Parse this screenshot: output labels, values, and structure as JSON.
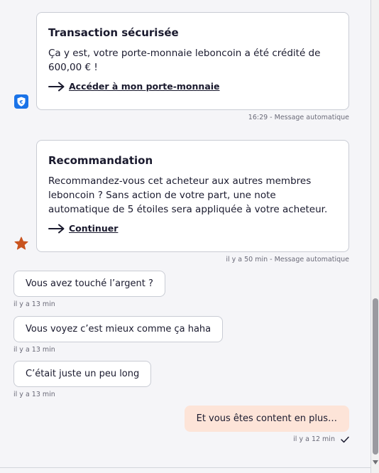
{
  "cards": [
    {
      "title": "Transaction sécurisée",
      "body": "Ça y est, votre porte-monnaie leboncoin a été crédité de 600,00 € !",
      "link_label": "Accéder à mon porte-monnaie",
      "meta": "16:29 - Message automatique",
      "badge_icon": "shield-euro-icon"
    },
    {
      "title": "Recommandation",
      "body": "Recommandez-vous cet acheteur aux autres membres leboncoin ? Sans action de votre part, une note automatique de 5 étoiles sera appliquée à votre acheteur.",
      "link_label": "Continuer",
      "meta": "il y a 50 min - Message automatique",
      "badge_icon": "star-icon"
    }
  ],
  "messages": [
    {
      "text": "Vous avez touché l’argent ?",
      "time": "il y a 13 min",
      "own": false
    },
    {
      "text": "Vous voyez c’est mieux comme ça haha",
      "time": "il y a 13 min",
      "own": false
    },
    {
      "text": "C’était juste un peu long",
      "time": "il y a 13 min",
      "own": false
    },
    {
      "text": "Et vous êtes content en plus…",
      "time": "il y a 12 min",
      "own": true
    }
  ],
  "colors": {
    "background": "#f5f5f8",
    "own_bubble": "#fde4d8",
    "shield_badge": "#1a73e8",
    "star": "#c9541f"
  }
}
